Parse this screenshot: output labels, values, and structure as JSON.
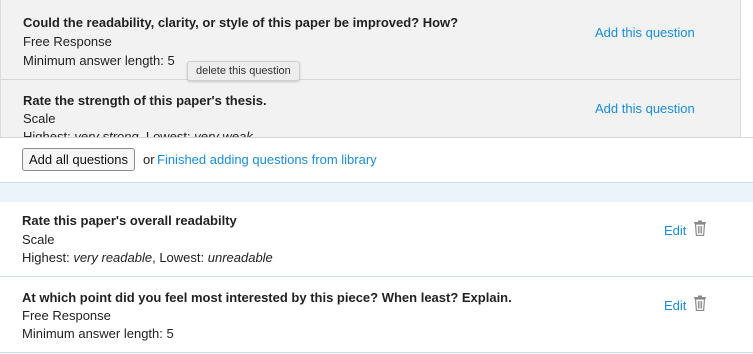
{
  "library": {
    "questions": [
      {
        "title": "Could the readability, clarity, or style of this paper be improved? How?",
        "type": "Free Response",
        "meta_text": "Minimum answer length: 5",
        "add_label": "Add this question"
      },
      {
        "title": "Rate the strength of this paper's thesis.",
        "type": "Scale",
        "highest_prefix": "Highest: ",
        "highest_value": "very strong",
        "lowest_prefix": ", Lowest: ",
        "lowest_value": "very weak",
        "add_label": "Add this question"
      }
    ],
    "tooltip": "delete this question"
  },
  "actions": {
    "add_all_label": "Add all questions",
    "or_text": "or",
    "finished_label": "Finished adding questions from library"
  },
  "added": {
    "questions": [
      {
        "title": "Rate this paper's overall readabilty",
        "type": "Scale",
        "highest_prefix": "Highest: ",
        "highest_value": "very readable",
        "lowest_prefix": ", Lowest: ",
        "lowest_value": "unreadable",
        "edit_label": "Edit",
        "delete_icon": "trash-icon"
      },
      {
        "title": "At which point did you feel most interested by this piece? When least? Explain.",
        "type": "Free Response",
        "meta_text": "Minimum answer length: 5",
        "edit_label": "Edit",
        "delete_icon": "trash-icon"
      }
    ]
  },
  "colors": {
    "link": "#1a8cd8",
    "library_bg": "#f2f2f2",
    "divider_band": "#ecf4fb",
    "row_border": "#c9dff0"
  }
}
